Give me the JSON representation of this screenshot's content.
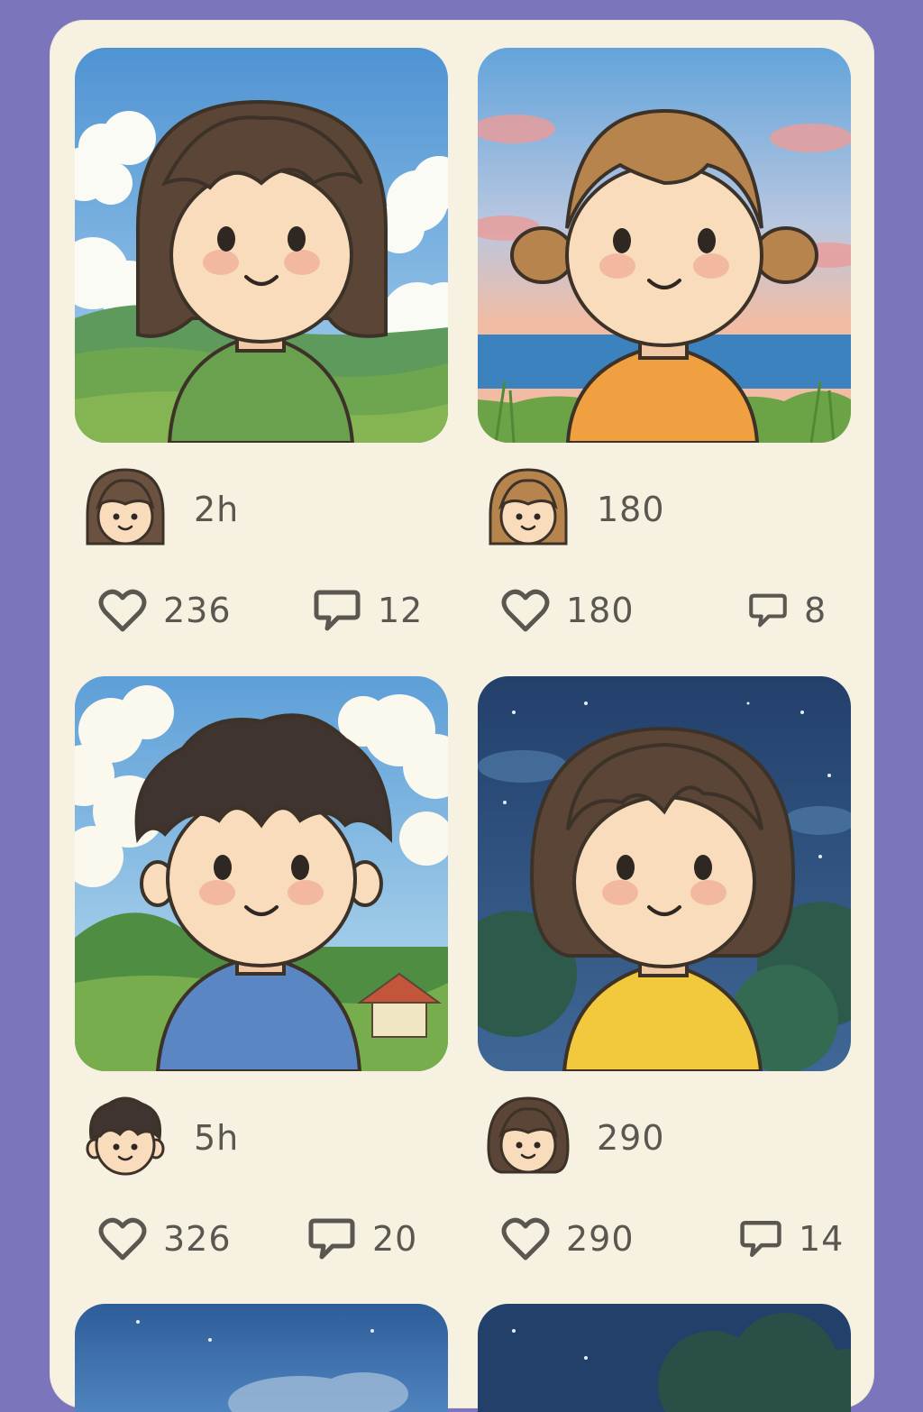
{
  "feed": {
    "cards": [
      {
        "meta": "2h",
        "likes": "236",
        "comments": "12",
        "shirt": "#6aa14f",
        "sky": "day",
        "hair": "bob-dark"
      },
      {
        "meta": "180",
        "likes": "180",
        "comments": "8",
        "shirt": "#f0a040",
        "sky": "sunset-sea",
        "hair": "pigtails"
      },
      {
        "meta": "5h",
        "likes": "326",
        "comments": "20",
        "shirt": "#5b86c4",
        "sky": "day-house",
        "hair": "short-boy"
      },
      {
        "meta": "290",
        "likes": "290",
        "comments": "14",
        "shirt": "#f2c83c",
        "sky": "night",
        "hair": "bob-wavy"
      }
    ]
  },
  "icons": {
    "like": "heart-icon",
    "comment": "speech-bubble-icon"
  },
  "colors": {
    "background": "#7b76bc",
    "panel": "#f7f1e2",
    "text": "#5a5650"
  }
}
